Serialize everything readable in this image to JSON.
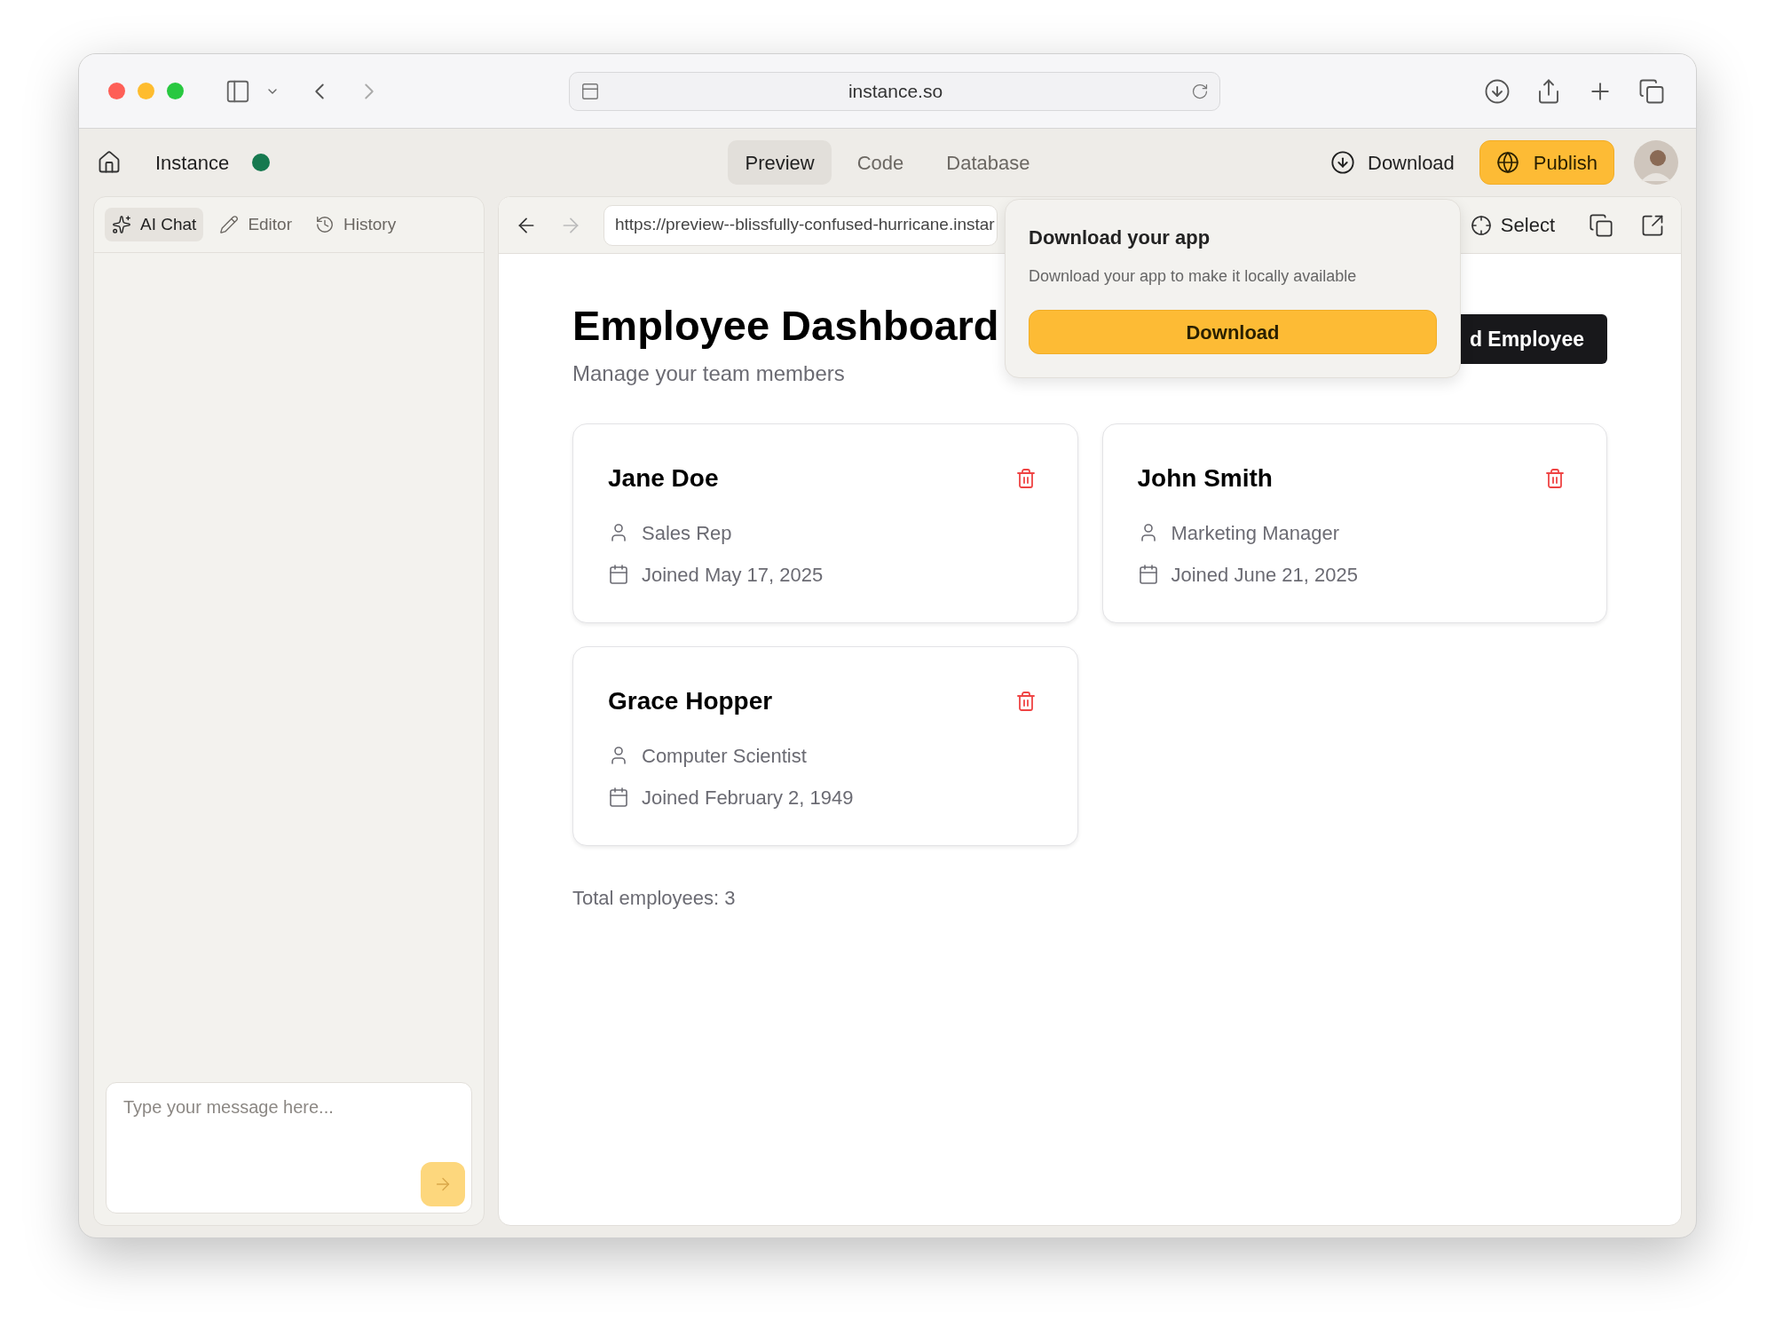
{
  "browser": {
    "address": "instance.so"
  },
  "app": {
    "name": "Instance",
    "tabs": [
      {
        "label": "Preview",
        "selected": true
      },
      {
        "label": "Code",
        "selected": false
      },
      {
        "label": "Database",
        "selected": false
      }
    ],
    "download": "Download",
    "publish": "Publish"
  },
  "sidebar": {
    "tabs": [
      {
        "label": "AI Chat",
        "selected": true
      },
      {
        "label": "Editor",
        "selected": false
      },
      {
        "label": "History",
        "selected": false
      }
    ],
    "message": {
      "placeholder": "Type your message here..."
    }
  },
  "preview": {
    "url": "https://preview--blissfully-confused-hurricane.instar",
    "select": "Select"
  },
  "popup": {
    "title": "Download your app",
    "description": "Download your app to make it locally available",
    "button": "Download"
  },
  "dashboard": {
    "title": "Employee Dashboard",
    "subtitle": "Manage your team members",
    "add_button": "d Employee",
    "employees": [
      {
        "name": "Jane Doe",
        "role": "Sales Rep",
        "joined": "Joined May 17, 2025"
      },
      {
        "name": "John Smith",
        "role": "Marketing Manager",
        "joined": "Joined June 21, 2025"
      },
      {
        "name": "Grace Hopper",
        "role": "Computer Scientist",
        "joined": "Joined February 2, 1949"
      }
    ],
    "total": "Total employees: 3"
  }
}
